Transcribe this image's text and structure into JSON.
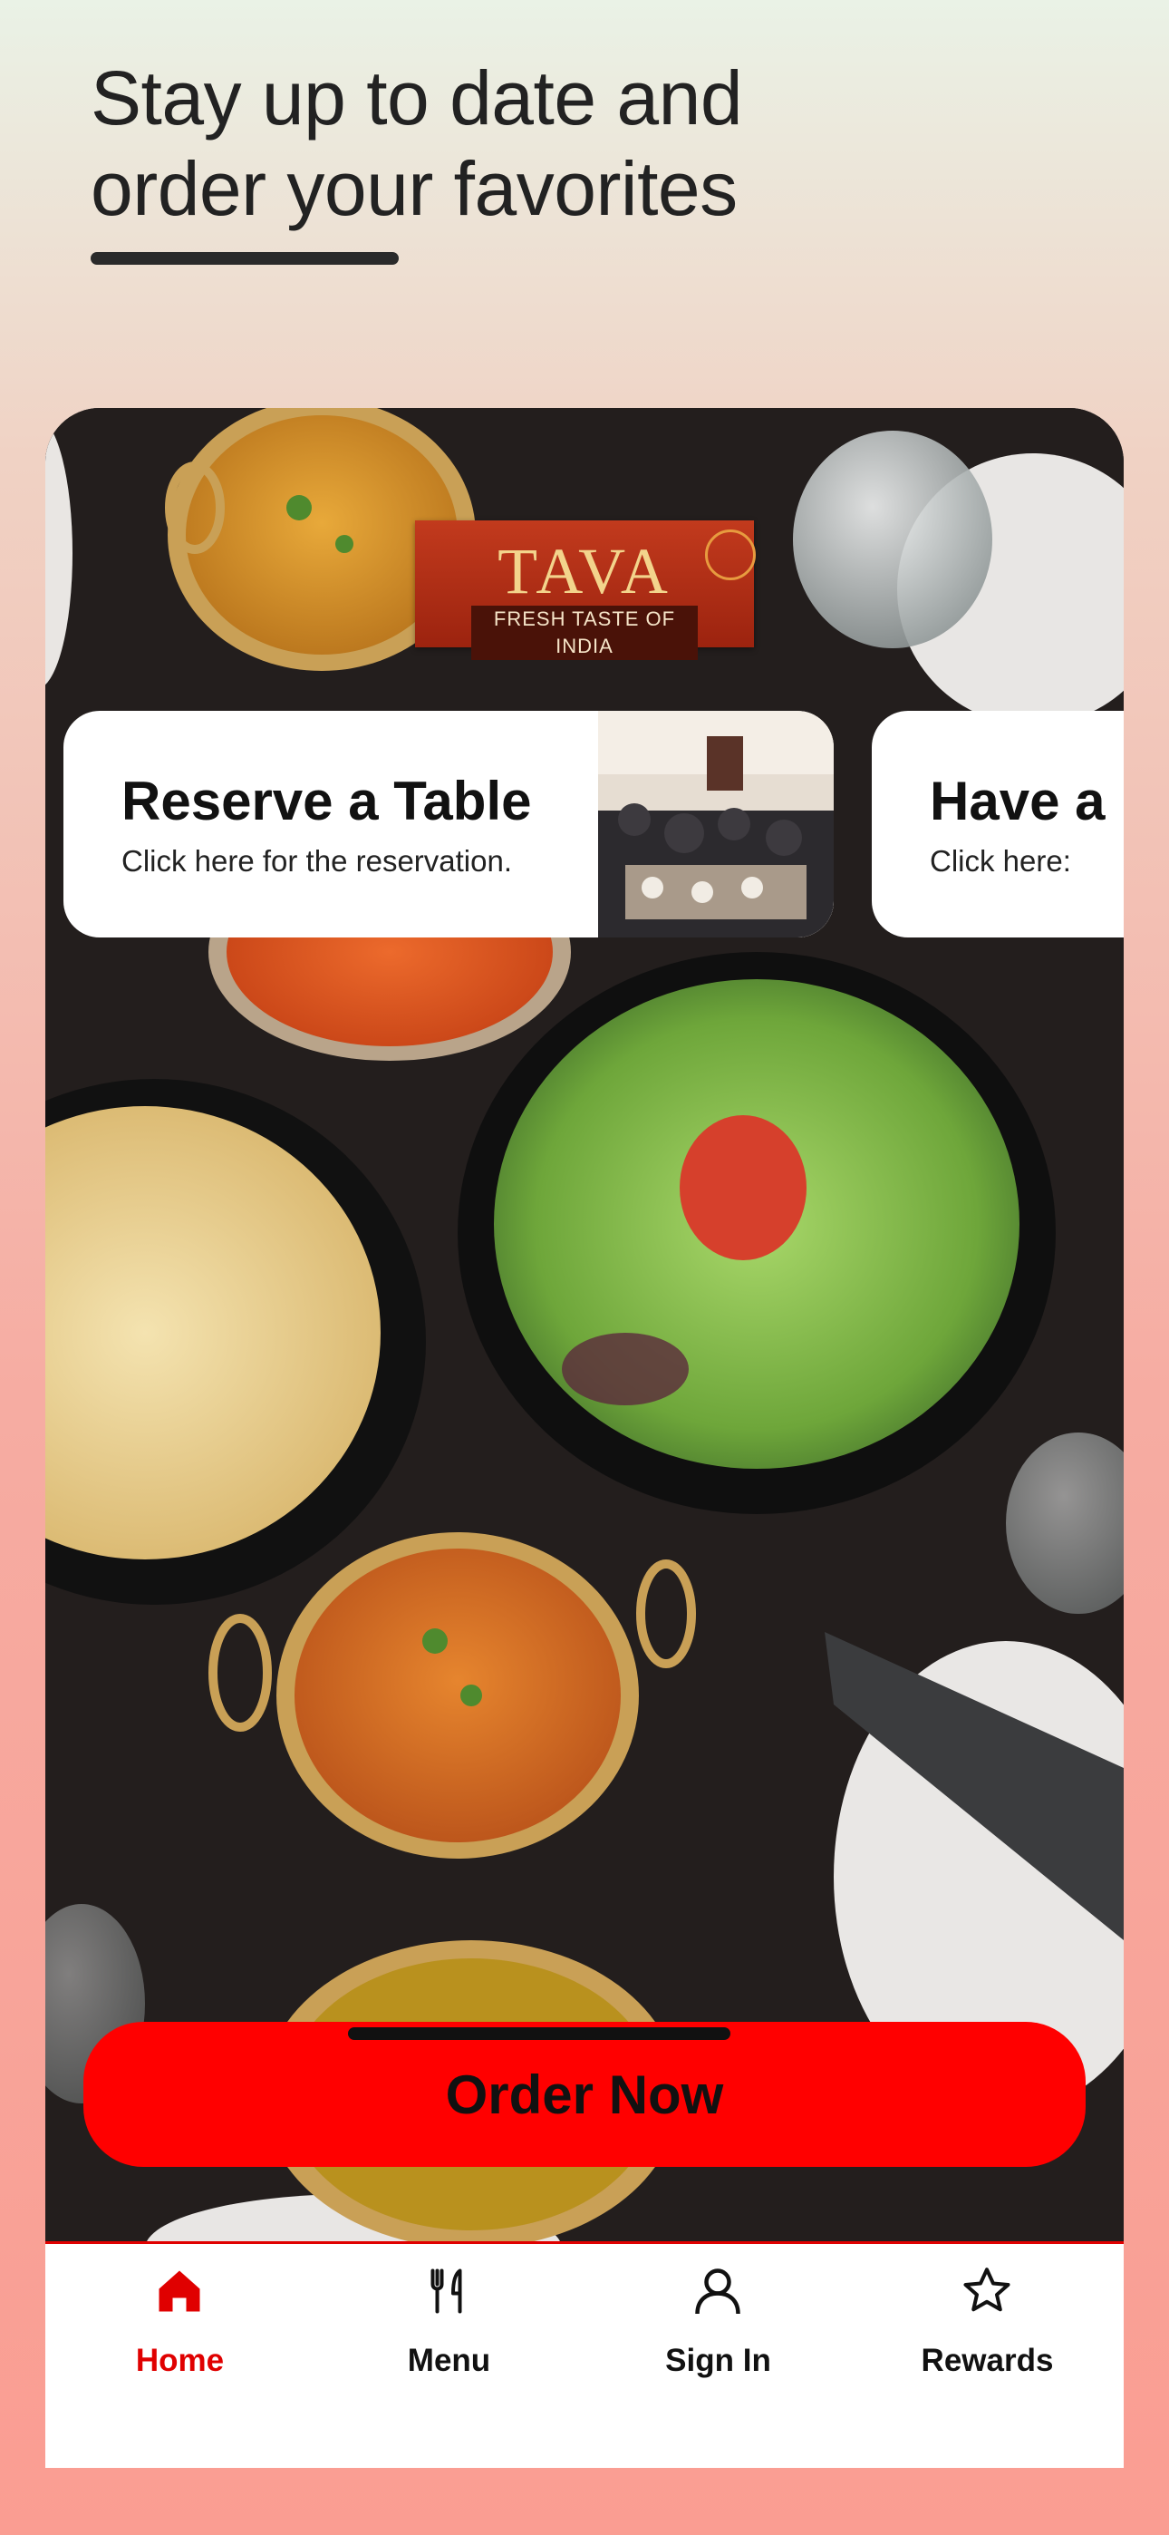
{
  "header": {
    "title_line1": "Stay up to date and",
    "title_line2": "order your favorites"
  },
  "logo": {
    "name": "TAVA",
    "tagline": "FRESH TASTE OF INDIA"
  },
  "cards": [
    {
      "title": "Reserve a Table",
      "subtitle": "Click here for the reservation."
    },
    {
      "title": "Have a",
      "subtitle": "Click here:"
    }
  ],
  "order_button": {
    "label": "Order Now"
  },
  "tabs": [
    {
      "label": "Home",
      "icon": "home-icon",
      "active": true
    },
    {
      "label": "Menu",
      "icon": "fork-knife-icon",
      "active": false
    },
    {
      "label": "Sign In",
      "icon": "user-icon",
      "active": false
    },
    {
      "label": "Rewards",
      "icon": "star-icon",
      "active": false
    }
  ],
  "colors": {
    "accent": "#ff0000",
    "active_tab": "#e00000",
    "text": "#111111"
  }
}
